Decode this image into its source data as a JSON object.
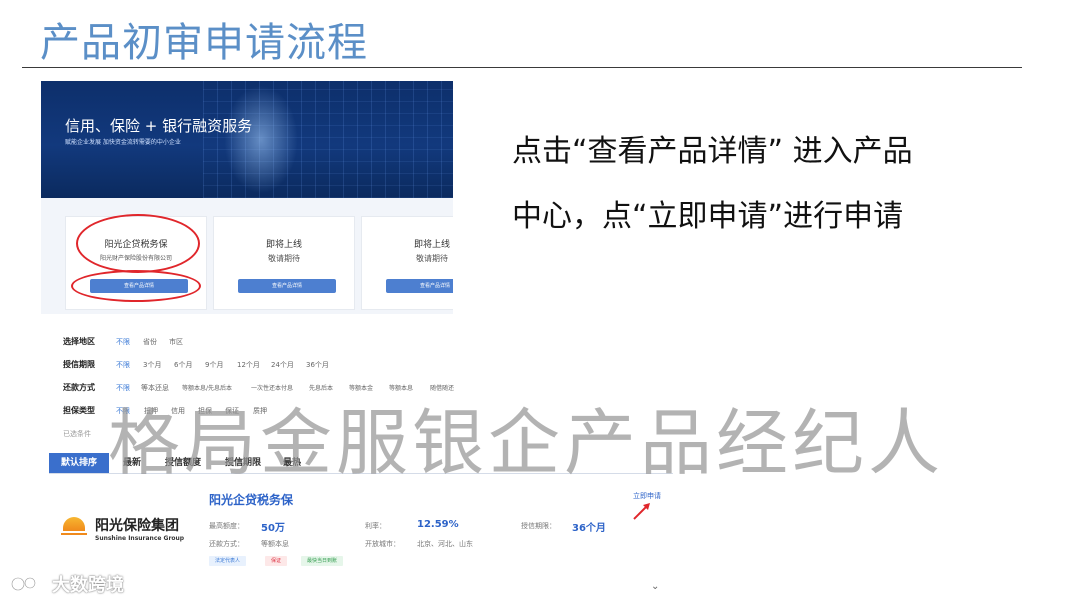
{
  "slide": {
    "title": "产品初审申请流程",
    "desc_line1": "点击“查看产品详情” 进入产品",
    "desc_line2": "中心，点“立即申请”进行申请"
  },
  "banner": {
    "title": "信用、保险 + 银行融资服务",
    "subtitle": "赋能企业发展  加快资金流转需要的中小企业"
  },
  "cards": [
    {
      "title": "阳光企贷税务保",
      "subtitle": "阳光财产保险股份有限公司",
      "button": "查看产品详情"
    },
    {
      "title": "即将上线",
      "subtitle": "敬请期待",
      "button": "查看产品详情"
    },
    {
      "title": "即将上线",
      "subtitle": "敬请期待",
      "button": "查看产品详情"
    }
  ],
  "filters": {
    "region": {
      "label": "选择地区",
      "options": [
        "不限",
        "省份",
        "市区"
      ]
    },
    "term": {
      "label": "授信期限",
      "options": [
        "不限",
        "3个月",
        "6个月",
        "9个月",
        "12个月",
        "24个月",
        "36个月"
      ]
    },
    "repay": {
      "label": "还款方式",
      "options": [
        "不限",
        "等本还息",
        "等额本息/先息后本",
        "一次性还本付息",
        "先息后本",
        "等额本金",
        "等额本息",
        "随借随还"
      ]
    },
    "guarantee": {
      "label": "担保类型",
      "options": [
        "不限",
        "抵押",
        "信用",
        "担保",
        "保证",
        "质押"
      ]
    },
    "selected": "已选条件"
  },
  "sort_tabs": [
    "默认排序",
    "最新",
    "授信额度",
    "授信期限",
    "最热"
  ],
  "product": {
    "name": "阳光企贷税务保",
    "apply": "立即申请",
    "company_cn": "阳光保险集团",
    "company_en": "Sunshine Insurance Group",
    "max_amount_label": "最高额度：",
    "max_amount": "50万",
    "rate_label": "利率：",
    "rate": "12.59%",
    "term_label": "授信期限：",
    "term": "36个月",
    "repay_label": "还款方式：",
    "repay": "等额本息",
    "cities_label": "开放城市：",
    "cities": "北京、河北、山东",
    "tags": [
      "法定代表人",
      "保证",
      "最快当日到账"
    ]
  },
  "watermark": "格局金服银企产品经纪人",
  "footer_brand": "大数跨境",
  "colors": {
    "title": "#5b8fc7",
    "accent": "#2d63c8",
    "highlight": "#e0262b"
  }
}
